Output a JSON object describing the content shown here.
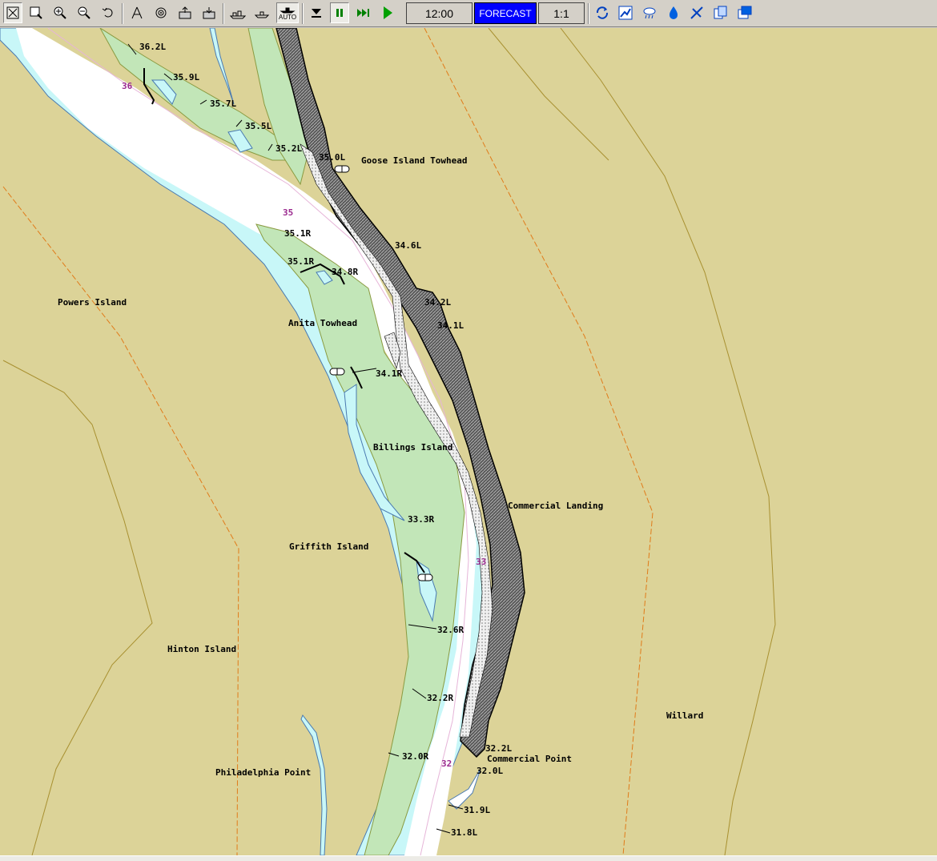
{
  "toolbar": {
    "time": "12:00",
    "forecast": "FORECAST",
    "scale": "1:1",
    "auto_label": "AUTO"
  },
  "icons": [
    "zoom-extents-icon",
    "zoom-window-icon",
    "zoom-in-icon",
    "zoom-out-icon",
    "undo-zoom-icon",
    "measure-icon",
    "target-icon",
    "export-icon",
    "import-icon",
    "vessel-icon",
    "boat-icon",
    "auto-vessel-icon",
    "step-down-icon",
    "pause-icon",
    "fast-forward-icon",
    "play-icon",
    "refresh-icon",
    "chart-icon",
    "weather-icon",
    "water-level-icon",
    "settings-icon",
    "copy-icon",
    "window-icon"
  ],
  "map": {
    "colors": {
      "land": "#dcd398",
      "water": "#c8f7f8",
      "channel": "#ffffff",
      "island": "#c2e6b8",
      "bluff": "#6a6a6a",
      "mile_marker": "#9b2a8f"
    },
    "place_labels": {
      "goose_island_towhead": "Goose Island Towhead",
      "powers_island": "Powers Island",
      "anita_towhead": "Anita Towhead",
      "billings_island": "Billings Island",
      "commercial_landing": "Commercial Landing",
      "griffith_island": "Griffith Island",
      "hinton_island": "Hinton Island",
      "willard": "Willard",
      "philadelphia_point": "Philadelphia Point",
      "commercial_point": "Commercial Point"
    },
    "mile_markers": {
      "m36": "36",
      "m35": "35",
      "m33": "33",
      "m32": "32"
    },
    "mile_labels": {
      "l362": "36.2L",
      "l359": "35.9L",
      "l357": "35.7L",
      "l355": "35.5L",
      "l352": "35.2L",
      "l350": "35.0L",
      "r351a": "35.1R",
      "r351b": "35.1R",
      "r348": "34.8R",
      "l346": "34.6L",
      "l342": "34.2L",
      "l341": "34.1L",
      "r341": "34.1R",
      "r333": "33.3R",
      "r326": "32.6R",
      "r322": "32.2R",
      "l322": "32.2L",
      "r320": "32.0R",
      "l320": "32.0L",
      "l319": "31.9L",
      "l318": "31.8L"
    }
  }
}
